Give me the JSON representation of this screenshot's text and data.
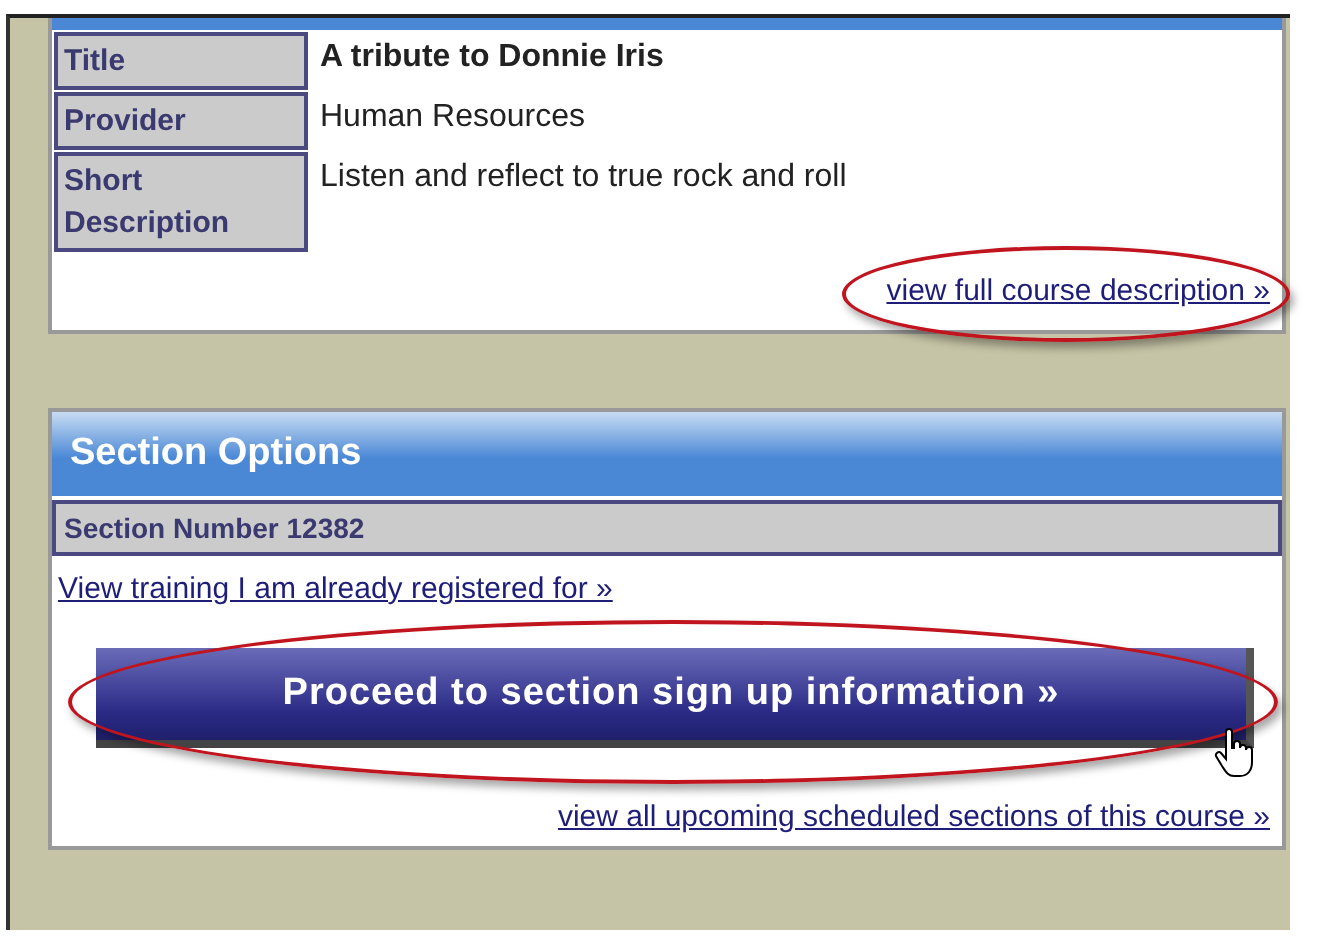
{
  "course_details": {
    "rows": [
      {
        "label": "Title",
        "value": "A tribute to Donnie Iris",
        "kind": "bold"
      },
      {
        "label": "Provider",
        "value": "Human Resources",
        "kind": "plain"
      },
      {
        "label": "Short Description",
        "value": "Listen and reflect to true rock and roll",
        "kind": "plain"
      }
    ],
    "link": "view full course description »"
  },
  "section_options": {
    "title": "Section Options",
    "section_number": "Section Number 12382",
    "registered_link": "View training I am already registered for »",
    "proceed_button": "Proceed to section sign up information »",
    "all_sections_link": "view all upcoming scheduled sections of this course »"
  }
}
